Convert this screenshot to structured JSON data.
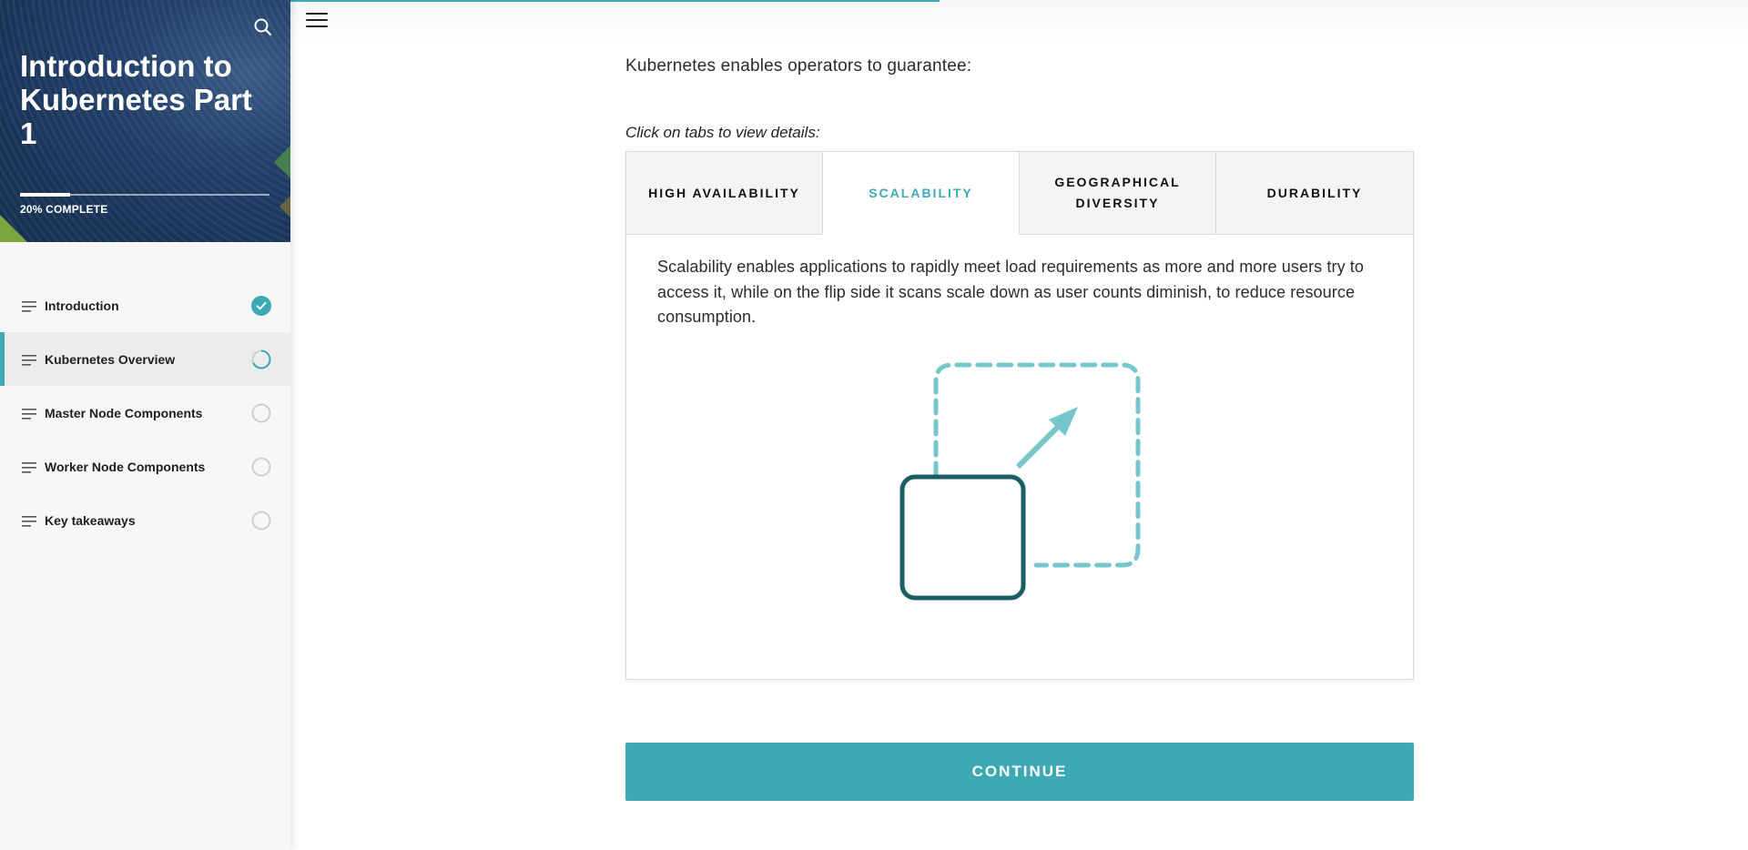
{
  "course": {
    "title": "Introduction to Kubernetes Part 1",
    "progress_label": "20% COMPLETE",
    "progress_percent": 20
  },
  "sidebar": {
    "lessons": [
      {
        "label": "Introduction",
        "status": "complete"
      },
      {
        "label": "Kubernetes Overview",
        "status": "in-progress",
        "active": true
      },
      {
        "label": "Master Node Components",
        "status": "not-started"
      },
      {
        "label": "Worker Node Components",
        "status": "not-started"
      },
      {
        "label": "Key takeaways",
        "status": "not-started"
      }
    ]
  },
  "icons": {
    "search": "search-icon",
    "menu": "hamburger-menu-icon",
    "lesson": "lines-icon",
    "complete": "check-circle-icon",
    "in_progress": "progress-ring-icon",
    "not_started": "empty-circle-icon",
    "illustration": "scale-up-icon"
  },
  "colors": {
    "accent": "#3ca9b4",
    "illustration_dark": "#1b5f66",
    "illustration_light": "#76c7cc",
    "hero": "#1a3459"
  },
  "main": {
    "intro": "Kubernetes enables operators to guarantee:",
    "instruction": "Click on tabs to view details:",
    "tabs": [
      {
        "label": "HIGH AVAILABILITY"
      },
      {
        "label": "SCALABILITY",
        "active": true
      },
      {
        "label": "GEOGRAPHICAL DIVERSITY"
      },
      {
        "label": "DURABILITY"
      }
    ],
    "active_tab_text": "Scalability enables applications to rapidly meet load requirements as more and more users try to access it, while on the flip side it scans scale down as user counts diminish, to reduce resource consumption.",
    "continue_label": "CONTINUE"
  }
}
